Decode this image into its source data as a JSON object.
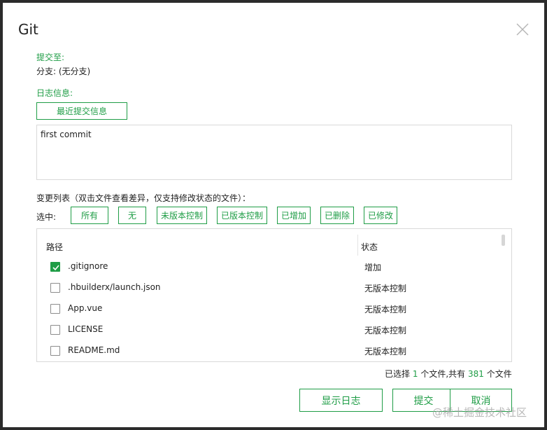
{
  "dialog": {
    "title": "Git"
  },
  "commit_to": {
    "label": "提交至:",
    "branch": "分支: (无分支)"
  },
  "log": {
    "label": "日志信息:",
    "recent_button": "最近提交信息",
    "message": "first commit"
  },
  "changes": {
    "label": "变更列表（双击文件查看差异，仅支持修改状态的文件）：",
    "select_label": "选中:",
    "filters": [
      "所有",
      "无",
      "未版本控制",
      "已版本控制",
      "已增加",
      "已删除",
      "已修改"
    ]
  },
  "table": {
    "headers": {
      "path": "路径",
      "status": "状态"
    },
    "rows": [
      {
        "name": ".gitignore",
        "status": "增加",
        "checked": true
      },
      {
        "name": ".hbuilderx/launch.json",
        "status": "无版本控制",
        "checked": false
      },
      {
        "name": "App.vue",
        "status": "无版本控制",
        "checked": false
      },
      {
        "name": "LICENSE",
        "status": "无版本控制",
        "checked": false
      },
      {
        "name": "README.md",
        "status": "无版本控制",
        "checked": false
      }
    ]
  },
  "summary": {
    "prefix": "已选择",
    "selected": "1",
    "middle": "个文件,共有",
    "total": "381",
    "suffix": "个文件"
  },
  "buttons": {
    "show_log": "显示日志",
    "commit": "提交",
    "cancel": "取消"
  },
  "watermark": "@稀土掘金技术社区",
  "colors": {
    "accent": "#1f9d46",
    "border": "#d9d9d9"
  }
}
